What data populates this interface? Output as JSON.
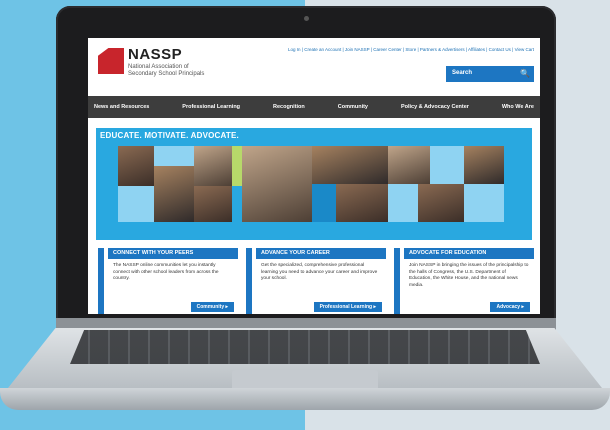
{
  "site": {
    "logo_name": "NASSP",
    "logo_subtitle": "National Association of Secondary School Principals",
    "utility_links": "Log In | Create an Account | Join NASSP | Career Center | Store | Partners & Advertisers | Affiliates | Contact Us | View Cart",
    "search": {
      "placeholder": "Search"
    }
  },
  "nav": {
    "items": [
      {
        "label": "News and Resources"
      },
      {
        "label": "Professional Learning"
      },
      {
        "label": "Recognition"
      },
      {
        "label": "Community"
      },
      {
        "label": "Policy & Advocacy Center"
      },
      {
        "label": "Who We Are"
      }
    ]
  },
  "hero": {
    "title": "EDUCATE. MOTIVATE. ADVOCATE."
  },
  "cards": [
    {
      "title": "CONNECT WITH YOUR PEERS",
      "body": "The NASSP online communities let you instantly connect with other school leaders from across the country.",
      "button": "Community"
    },
    {
      "title": "ADVANCE YOUR CAREER",
      "body": "Get the specialized, comprehensive professional learning you need to advance your career and improve your school.",
      "button": "Professional Learning"
    },
    {
      "title": "ADVOCATE FOR EDUCATION",
      "body": "Join NASSP in bringing the issues of the principalship to the halls of Congress, the U.S. Department of Education, the White House, and the national news media.",
      "button": "Advocacy"
    }
  ],
  "colors": {
    "brand_blue": "#1d76c2",
    "brand_red": "#c8252c",
    "nav_dark": "#3d3d3d",
    "hero_blue": "#29a8e0"
  }
}
